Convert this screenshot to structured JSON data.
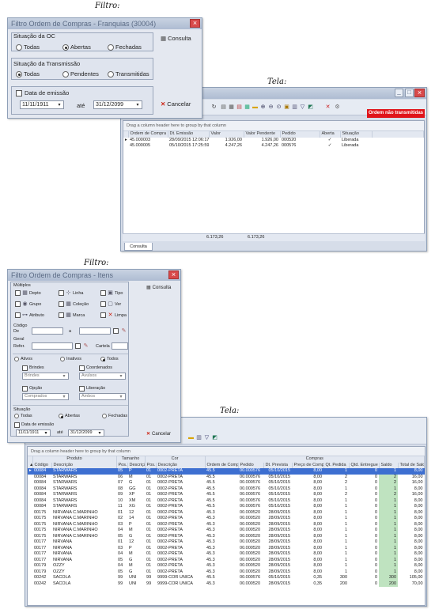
{
  "captions": {
    "filtro1": "Filtro:",
    "tela1": "Tela:",
    "filtro2": "Filtro:",
    "tela2": "Tela:"
  },
  "dlg1": {
    "title": "Filtro Ordem de Compras - Franquias (30004)",
    "situacao_oc": {
      "label": "Situação da OC",
      "options": [
        "Todas",
        "Abertas",
        "Fechadas"
      ],
      "selected": "Abertas"
    },
    "situacao_trans": {
      "label": "Situação da Transmissão",
      "options": [
        "Todas",
        "Pendentes",
        "Transmitidas"
      ],
      "selected": "Todas"
    },
    "data_emissao_label": "Data de emissão",
    "date_from": "11/11/1911",
    "ate": "até",
    "date_to": "31/12/2099",
    "consulta": "Consulta",
    "cancelar": "Cancelar"
  },
  "win1": {
    "badge": "Ordem não transmitidas",
    "group_hint": "Drag a column header here to group by that column",
    "columns": [
      "Ordem de Compra",
      "Dt. Emissão",
      "Valor",
      "Valor Pendente",
      "Pedido",
      "Aberta",
      "Situação"
    ],
    "rows": [
      [
        "45.000003",
        "28/09/2015 12:06:17",
        "1.926,00",
        "1.926,00",
        "000520",
        "✓",
        "Liberada"
      ],
      [
        "45.000005",
        "05/10/2015 17:25:59",
        "4.247,26",
        "4.247,26",
        "000576",
        "✓",
        "Liberada"
      ]
    ],
    "total_valor": "6.173,26",
    "total_pend": "6.173,26",
    "tab": "Consulta"
  },
  "dlg2": {
    "title": "Filtro Ordem de Compras - Itens",
    "multiplos": "Múltiplos",
    "checks": [
      [
        "Depto",
        "Linha",
        "Tipo"
      ],
      [
        "Grupo",
        "Coleção",
        "Ver"
      ],
      [
        "Atributo",
        "Marca",
        "Limpa"
      ]
    ],
    "codigo": "Código",
    "de": "De",
    "a": "a",
    "geral": "Geral",
    "refer": "Refer.",
    "cartela": "Cartela",
    "status_options": [
      "Ativos",
      "Inativos",
      "Todos"
    ],
    "status_selected": "Todos",
    "brindes": "Brindes",
    "brindes_val": "Brindes",
    "coordenados": "Coordenados",
    "coordenados_val": "Avulsos",
    "opcao": "Opção",
    "opcao_val": "Comprados",
    "liberacao": "Liberação",
    "liberacao_val": "Ambos",
    "situacao": "Situação",
    "sit_options": [
      "Todas",
      "Abertas",
      "Fechadas"
    ],
    "sit_selected": "Abertas",
    "data_emissao_label": "Data de emissão",
    "date_from": "11/11/1911",
    "ate": "até",
    "date_to": "31/12/2099",
    "consulta": "Consulta",
    "cancelar": "Cancelar"
  },
  "win2": {
    "group_hint": "Drag a column header here to group by that column",
    "bands": [
      "Produto",
      "Tamanho",
      "Cor",
      "Compras"
    ],
    "columns": [
      "Código",
      "Descrição",
      "Pos.",
      "Descrição",
      "Pos.",
      "Descrição",
      "Ordem de Compra",
      "Pedido",
      "Dt. Prevista",
      "Preço de Compra",
      "Qt. Pedida",
      "Qtd. Entregue",
      "Saldo",
      "Total de Saldo"
    ],
    "rows": [
      [
        "00084",
        "STARWARS",
        "05",
        "P",
        "01",
        "0002-PRETA",
        "45.5",
        "00.000576",
        "05/10/2015",
        "8,00",
        "1",
        "0",
        "1",
        "8,00"
      ],
      [
        "00084",
        "STARWARS",
        "06",
        "M",
        "01",
        "0002-PRETA",
        "45.5",
        "00.000576",
        "05/10/2015",
        "8,00",
        "2",
        "0",
        "2",
        "16,00"
      ],
      [
        "00084",
        "STARWARS",
        "07",
        "G",
        "01",
        "0002-PRETA",
        "45.5",
        "00.000576",
        "05/10/2015",
        "8,00",
        "2",
        "0",
        "2",
        "16,00"
      ],
      [
        "00084",
        "STARWARS",
        "08",
        "GG",
        "01",
        "0002-PRETA",
        "45.5",
        "00.000576",
        "05/10/2015",
        "8,00",
        "1",
        "0",
        "1",
        "8,00"
      ],
      [
        "00084",
        "STARWARS",
        "09",
        "XP",
        "01",
        "0002-PRETA",
        "45.5",
        "00.000576",
        "05/10/2015",
        "8,00",
        "2",
        "0",
        "2",
        "16,00"
      ],
      [
        "00084",
        "STARWARS",
        "10",
        "XM",
        "01",
        "0002-PRETA",
        "45.5",
        "00.000576",
        "05/10/2015",
        "8,00",
        "1",
        "0",
        "1",
        "8,00"
      ],
      [
        "00084",
        "STARWARS",
        "11",
        "XG",
        "01",
        "0002-PRETA",
        "45.5",
        "00.000576",
        "05/10/2015",
        "8,00",
        "1",
        "0",
        "1",
        "8,00"
      ],
      [
        "00175",
        "NIRVANA C.MARINHO",
        "01",
        "12",
        "01",
        "0002-PRETA",
        "45.3",
        "00.000520",
        "28/09/2015",
        "8,00",
        "1",
        "0",
        "1",
        "8,00"
      ],
      [
        "00175",
        "NIRVANA C.MARINHO",
        "02",
        "14",
        "01",
        "0002-PRETA",
        "45.3",
        "00.000520",
        "28/09/2015",
        "8,00",
        "1",
        "0",
        "1",
        "8,00"
      ],
      [
        "00175",
        "NIRVANA C.MARINHO",
        "03",
        "P",
        "01",
        "0002-PRETA",
        "45.3",
        "00.000520",
        "28/09/2015",
        "8,00",
        "1",
        "0",
        "1",
        "8,00"
      ],
      [
        "00175",
        "NIRVANA C.MARINHO",
        "04",
        "M",
        "01",
        "0002-PRETA",
        "45.3",
        "00.000520",
        "28/09/2015",
        "8,00",
        "1",
        "0",
        "1",
        "8,00"
      ],
      [
        "00175",
        "NIRVANA C.MARINHO",
        "05",
        "G",
        "01",
        "0002-PRETA",
        "45.3",
        "00.000520",
        "28/09/2015",
        "8,00",
        "1",
        "0",
        "1",
        "8,00"
      ],
      [
        "00177",
        "NIRVANA",
        "01",
        "12",
        "01",
        "0002-PRETA",
        "45.3",
        "00.000520",
        "28/09/2015",
        "8,00",
        "1",
        "0",
        "1",
        "8,00"
      ],
      [
        "00177",
        "NIRVANA",
        "03",
        "P",
        "01",
        "0002-PRETA",
        "45.3",
        "00.000520",
        "28/09/2015",
        "8,00",
        "1",
        "0",
        "1",
        "8,00"
      ],
      [
        "00177",
        "NIRVANA",
        "04",
        "M",
        "01",
        "0002-PRETA",
        "45.3",
        "00.000520",
        "28/09/2015",
        "8,00",
        "1",
        "0",
        "1",
        "8,00"
      ],
      [
        "00177",
        "NIRVANA",
        "05",
        "G",
        "01",
        "0002-PRETA",
        "45.3",
        "00.000520",
        "28/09/2015",
        "8,00",
        "1",
        "0",
        "1",
        "8,00"
      ],
      [
        "00179",
        "OZZY",
        "04",
        "M",
        "01",
        "0002-PRETA",
        "45.3",
        "00.000520",
        "28/09/2015",
        "8,00",
        "1",
        "0",
        "1",
        "8,00"
      ],
      [
        "00179",
        "OZZY",
        "05",
        "G",
        "01",
        "0002-PRETA",
        "45.3",
        "00.000520",
        "28/09/2015",
        "8,00",
        "1",
        "0",
        "1",
        "8,00"
      ],
      [
        "00242",
        "SACOLA",
        "99",
        "UNI",
        "99",
        "9999-COR UNICA",
        "45.5",
        "00.000576",
        "05/10/2015",
        "0,35",
        "300",
        "0",
        "300",
        "105,00"
      ],
      [
        "00242",
        "SACOLA",
        "99",
        "UNI",
        "99",
        "9999-COR UNICA",
        "45.3",
        "00.000520",
        "28/09/2015",
        "0,35",
        "200",
        "0",
        "200",
        "70,00"
      ]
    ]
  }
}
